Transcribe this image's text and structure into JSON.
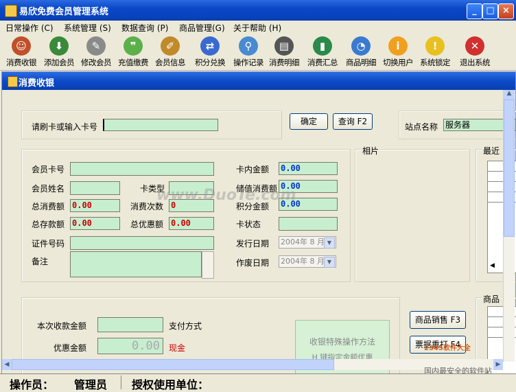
{
  "window": {
    "title": "易欣免费会员管理系统",
    "min": "_",
    "max": "□",
    "close": "×"
  },
  "menu": [
    "日常操作 (C)",
    "系统管理 (S)",
    "数据查询 (P)",
    "商品管理(G)",
    "关于帮助 (H)"
  ],
  "toolbar": [
    {
      "label": "消费收银",
      "icon": "user-icon",
      "color": "#c0502a"
    },
    {
      "label": "添加会员",
      "icon": "save-disk-icon",
      "color": "#3a8a3a"
    },
    {
      "label": "修改会员",
      "icon": "edit-pen-icon",
      "color": "#8a8a8a"
    },
    {
      "label": "充值缴费",
      "icon": "chat-bubbles-icon",
      "color": "#5bb04a"
    },
    {
      "label": "会员信息",
      "icon": "chart-pencil-icon",
      "color": "#c08a2a"
    },
    {
      "label": "积分兑换",
      "icon": "exchange-icon",
      "color": "#3a6ad0"
    },
    {
      "label": "操作记录",
      "icon": "magnifier-icon",
      "color": "#4a8ad0"
    },
    {
      "label": "消费明细",
      "icon": "printer-icon",
      "color": "#555555"
    },
    {
      "label": "消费汇总",
      "icon": "bar-chart-icon",
      "color": "#2a8a4a"
    },
    {
      "label": "商品明细",
      "icon": "pie-chart-icon",
      "color": "#3a7ad0"
    },
    {
      "label": "切换用户",
      "icon": "info-icon",
      "color": "#f0a020"
    },
    {
      "label": "系统锁定",
      "icon": "warning-icon",
      "color": "#e8c020"
    },
    {
      "label": "退出系统",
      "icon": "exit-icon",
      "color": "#d03030"
    }
  ],
  "inner": {
    "title": "消费收银"
  },
  "card": {
    "prompt": "请刷卡或输入卡号",
    "confirm": "确定",
    "query": "查询 F2",
    "station_label": "站点名称",
    "station_value": "服务器"
  },
  "member": {
    "card_no": "会员卡号",
    "name": "会员姓名",
    "card_type": "卡类型",
    "total_spend": "总消费额",
    "total_spend_val": "0.00",
    "spend_count": "消费次数",
    "spend_count_val": "0",
    "total_deposit": "总存款额",
    "total_deposit_val": "0.00",
    "total_discount": "总优惠额",
    "total_discount_val": "0.00",
    "id_no": "证件号码",
    "remark": "备注",
    "card_balance": "卡内金额",
    "card_balance_val": "0.00",
    "stored_spend": "储值消费额",
    "stored_spend_val": "0.00",
    "points": "积分金额",
    "points_val": "0.00",
    "status": "卡状态",
    "issue_date": "发行日期",
    "issue_date_val": "2004年 8 月",
    "void_date": "作废日期",
    "void_date_val": "2004年 8 月"
  },
  "photo": "相片",
  "recent": "最近",
  "goods": "商品",
  "payment": {
    "amount_label": "本次收款金额",
    "method_label": "支付方式",
    "discount_label": "优惠金额",
    "discount_val": "0.00",
    "method_val": "现金",
    "special_btn": "收银特殊操作方法",
    "special_hint": "H 键指定金额优惠"
  },
  "buttons": {
    "goods_sale": "商品销售 F3",
    "reprint": "票据重打 F4"
  },
  "watermark": "www.DuoTe.com",
  "corner_logo": "2345软件大全",
  "corner_slogan": "国内最安全的软件站",
  "status": {
    "operator_label": "操作员：",
    "operator": "管理员",
    "licensee_label": "授权使用单位："
  }
}
